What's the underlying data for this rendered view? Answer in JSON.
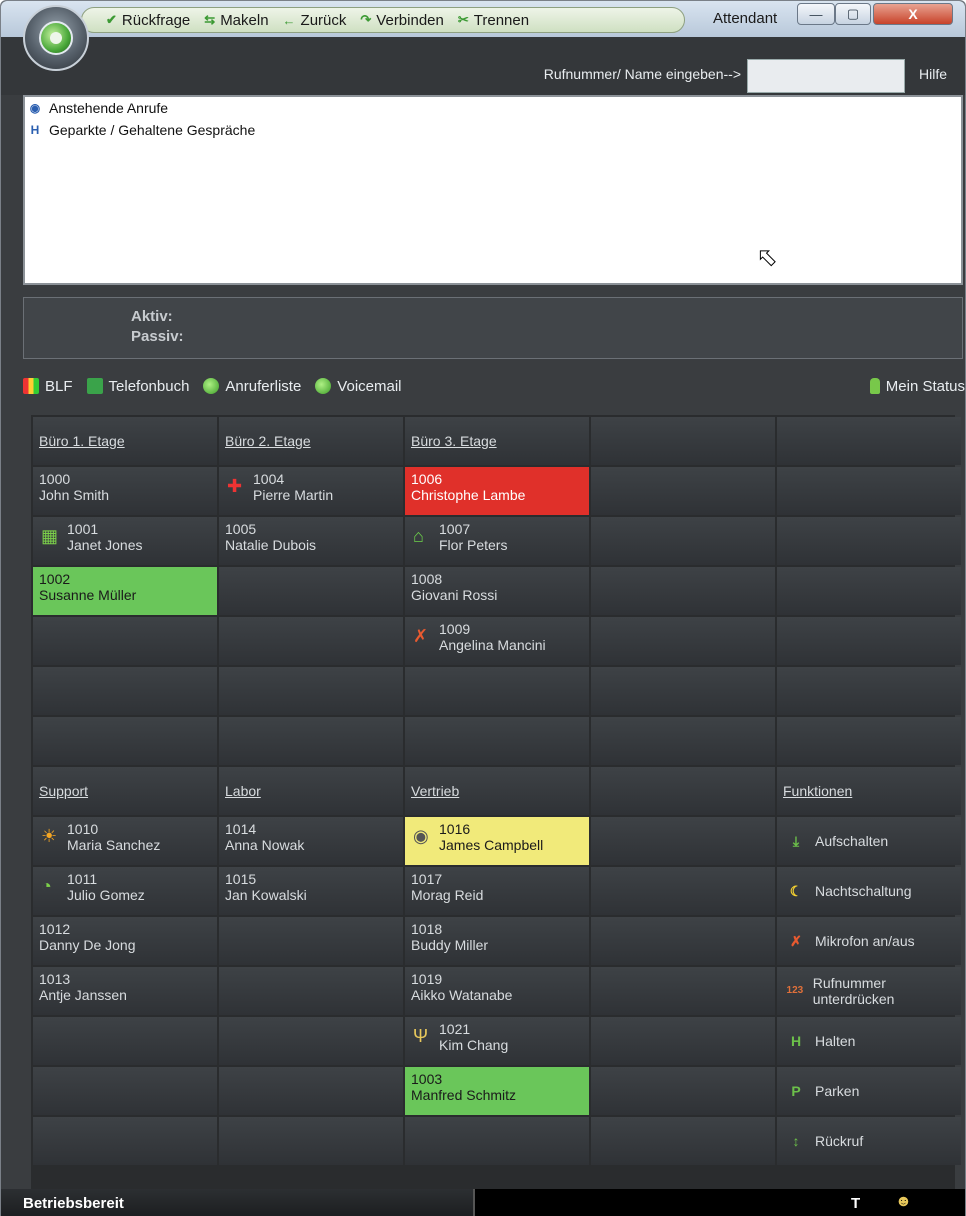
{
  "window": {
    "title": "Attendant",
    "minimize": "—",
    "maximize": "▢",
    "close": "X"
  },
  "toolbar": {
    "items": [
      {
        "label": "Rückfrage",
        "icon": "✔"
      },
      {
        "label": "Makeln",
        "icon": "⇆"
      },
      {
        "label": "Zurück",
        "icon": "←"
      },
      {
        "label": "Verbinden",
        "icon": "↷"
      },
      {
        "label": "Trennen",
        "icon": "✂"
      }
    ]
  },
  "search": {
    "label": "Rufnummer/ Name eingeben-->",
    "value": "",
    "placeholder": "",
    "help": "Hilfe"
  },
  "calls": {
    "items": [
      {
        "label": "Anstehende Anrufe",
        "icon": "◉"
      },
      {
        "label": "Geparkte / Gehaltene Gespräche",
        "icon": "H"
      }
    ]
  },
  "status": {
    "active": "Aktiv:",
    "passive": "Passiv:"
  },
  "tabs": {
    "blf": "BLF",
    "phonebook": "Telefonbuch",
    "calllist": "Anruferliste",
    "voicemail": "Voicemail",
    "mystatus": "Mein Status"
  },
  "groups": {
    "g1": "Büro 1. Etage",
    "g2": "Büro 2. Etage",
    "g3": "Büro 3. Etage",
    "g4": "Support",
    "g5": "Labor",
    "g6": "Vertrieb",
    "g7": "Funktionen"
  },
  "ext": {
    "e1000": {
      "num": "1000",
      "name": "John Smith"
    },
    "e1001": {
      "num": "1001",
      "name": "Janet Jones",
      "icon": "▦"
    },
    "e1002": {
      "num": "1002",
      "name": "Susanne Müller"
    },
    "e1004": {
      "num": "1004",
      "name": "Pierre Martin",
      "icon": "✚"
    },
    "e1005": {
      "num": "1005",
      "name": "Natalie Dubois"
    },
    "e1006": {
      "num": "1006",
      "name": "Christophe Lambe"
    },
    "e1007": {
      "num": "1007",
      "name": "Flor Peters",
      "icon": "⌂"
    },
    "e1008": {
      "num": "1008",
      "name": "Giovani Rossi"
    },
    "e1009": {
      "num": "1009",
      "name": "Angelina Mancini",
      "icon": "✗"
    },
    "e1010": {
      "num": "1010",
      "name": "Maria Sanchez",
      "icon": "☀"
    },
    "e1011": {
      "num": "1011",
      "name": "Julio Gomez",
      "icon": "◔"
    },
    "e1012": {
      "num": "1012",
      "name": "Danny De Jong"
    },
    "e1013": {
      "num": "1013",
      "name": "Antje Janssen"
    },
    "e1014": {
      "num": "1014",
      "name": "Anna Nowak"
    },
    "e1015": {
      "num": "1015",
      "name": "Jan Kowalski"
    },
    "e1016": {
      "num": "1016",
      "name": "James Campbell",
      "icon": "◉"
    },
    "e1017": {
      "num": "1017",
      "name": "Morag Reid"
    },
    "e1018": {
      "num": "1018",
      "name": "Buddy Miller"
    },
    "e1019": {
      "num": "1019",
      "name": "Aikko Watanabe"
    },
    "e1021": {
      "num": "1021",
      "name": "Kim Chang",
      "icon": "Ψ"
    },
    "e1003": {
      "num": "1003",
      "name": "Manfred Schmitz"
    }
  },
  "functions": [
    {
      "label": "Aufschalten",
      "icon": "⤓"
    },
    {
      "label": "Nachtschaltung",
      "icon": "☾"
    },
    {
      "label": "Mikrofon an/aus",
      "icon": "✗"
    },
    {
      "label": "Rufnummer unterdrücken",
      "icon": "123"
    },
    {
      "label": "Halten",
      "icon": "H"
    },
    {
      "label": "Parken",
      "icon": "P"
    },
    {
      "label": "Rückruf",
      "icon": "↕"
    }
  ],
  "statusbar": {
    "left": "Betriebsbereit",
    "t": "T",
    "users_icon": "☻"
  },
  "colors": {
    "busy": "#e0302a",
    "free": "#6ac65a",
    "ringing": "#f1ea7a"
  }
}
